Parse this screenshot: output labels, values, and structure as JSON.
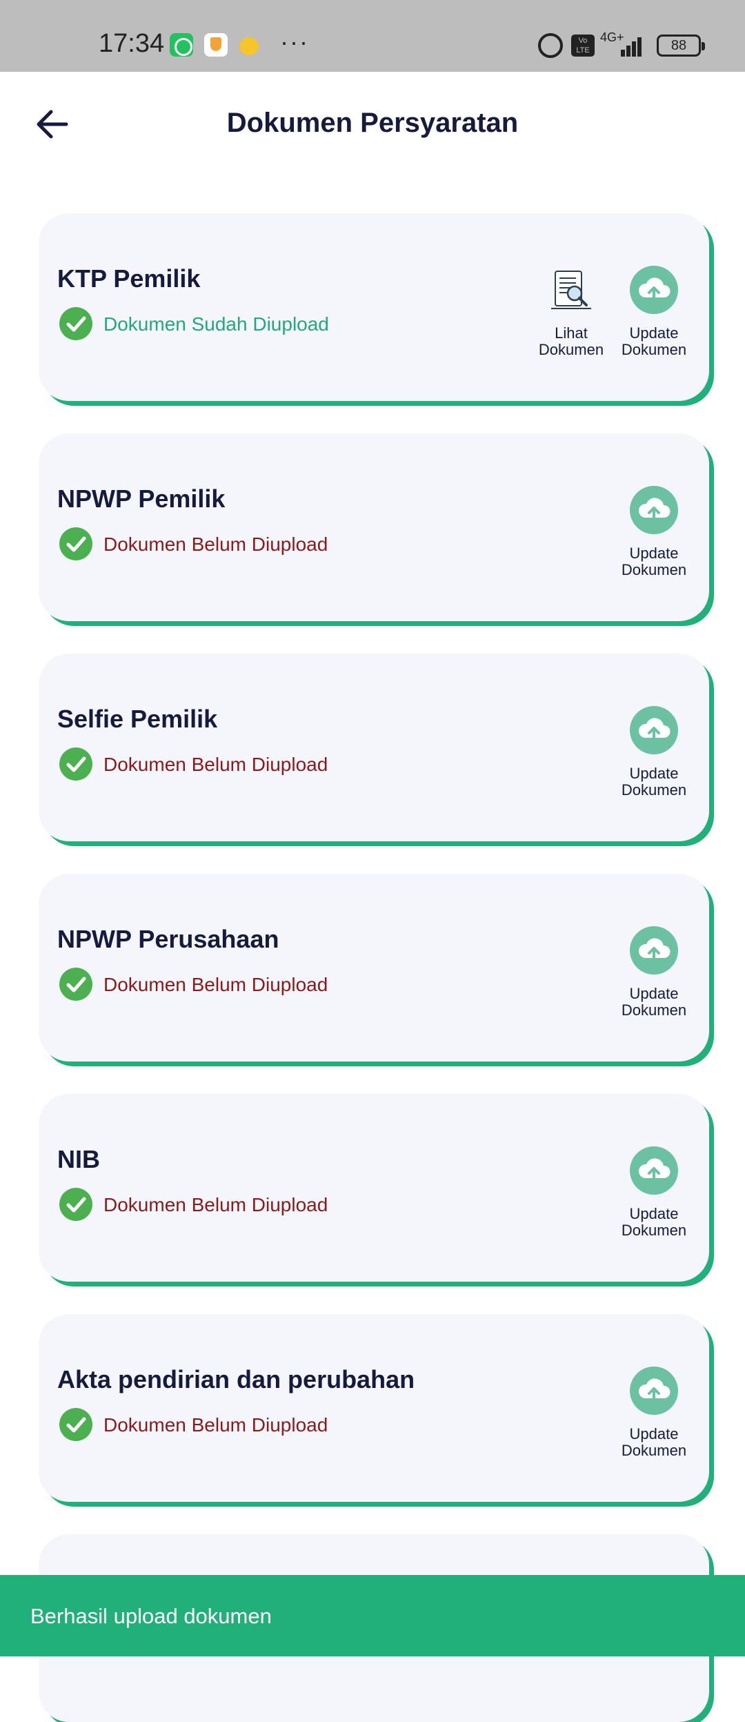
{
  "status_bar": {
    "time": "17:34",
    "dots": "···",
    "volte": "Vo LTE",
    "network": "4G+",
    "battery": "88",
    "icons": [
      "whatsapp-icon",
      "shield-icon",
      "emoji-icon",
      "alarm-icon",
      "volte-icon",
      "signal-icon",
      "battery-icon"
    ]
  },
  "header": {
    "title": "Dokumen Persyaratan",
    "back_icon": "arrow-left-icon"
  },
  "colors": {
    "accent": "#22b07a",
    "title": "#161b3d",
    "status_ok": "#22a87a",
    "status_no": "#8b1a1a",
    "check": "#4caf50",
    "upload": "#6cc1a2"
  },
  "documents": [
    {
      "title": "KTP Pemilik",
      "status": "Dokumen Sudah Diupload",
      "view_label": "Lihat Dokumen",
      "update_label": "Update Dokumen"
    },
    {
      "title": "NPWP Pemilik",
      "status": "Dokumen Belum Diupload",
      "update_label": "Update Dokumen"
    },
    {
      "title": "Selfie Pemilik",
      "status": "Dokumen Belum Diupload",
      "update_label": "Update Dokumen"
    },
    {
      "title": "NPWP Perusahaan",
      "status": "Dokumen Belum Diupload",
      "update_label": "Update Dokumen"
    },
    {
      "title": "NIB",
      "status": "Dokumen Belum Diupload",
      "update_label": "Update Dokumen"
    },
    {
      "title": "Akta pendirian dan perubahan",
      "status": "Dokumen Belum Diupload",
      "update_label": "Update Dokumen"
    }
  ],
  "snackbar": {
    "message": "Berhasil upload dokumen"
  }
}
